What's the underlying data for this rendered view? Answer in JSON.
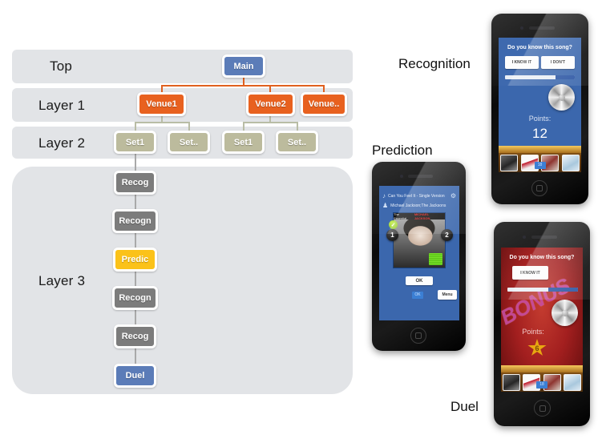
{
  "diagram": {
    "bands": [
      {
        "label": "Top"
      },
      {
        "label": "Layer 1"
      },
      {
        "label": "Layer 2"
      },
      {
        "label": "Layer 3"
      }
    ],
    "nodes": {
      "main": "Main",
      "venue1": "Venue1",
      "venue2": "Venue2",
      "venue_more": "Venue..",
      "set1a": "Set1",
      "set_more_a": "Set..",
      "set1b": "Set1",
      "set_more_b": "Set..",
      "recog1": "Recog",
      "recogn2": "Recogn",
      "predic": "Predic",
      "recogn4": "Recogn",
      "recog5": "Recog",
      "duel": "Duel"
    },
    "colors": {
      "band": "#e2e4e7",
      "main": "#5b7cb8",
      "venue": "#e8611f",
      "set": "#bcbb9d",
      "recog": "#7c7c7c",
      "predic": "#fbc219",
      "duel": "#5b7cb8",
      "connector_orange": "#e0601f",
      "connector_olive": "#b9bda6",
      "connector_grey": "#a9a9a9"
    }
  },
  "photos": {
    "captions": {
      "recognition": "Recognition",
      "prediction": "Prediction",
      "duel": "Duel"
    },
    "recognition_phone": {
      "question": "Do you know this song?",
      "button_yes": "I KNOW IT",
      "button_no": "I DON'T",
      "points_label": "Points:",
      "points_value": "12",
      "dock_badge": "18",
      "background_color": "#3b67ad"
    },
    "prediction_phone": {
      "song_title": "Can You Feel It - Single Version",
      "artist": "Michael Jackson;The Jacksons",
      "album_banner_prefix": "The Essential",
      "album_banner_name": "MICHAEL JACKSON",
      "left_badge": "1",
      "right_badge": "2",
      "check_mark": "✓",
      "ok_button": "OK",
      "menu_button": "Menu",
      "small_button": "OK",
      "background_color": "#3b67ad"
    },
    "duel_phone": {
      "question": "Do you know this song?",
      "button_yes": "I KNOW IT",
      "watermark": "BONUS",
      "points_label": "Points:",
      "points_value": "6",
      "dock_badge": "18",
      "background_color": "#a31f1f"
    }
  }
}
